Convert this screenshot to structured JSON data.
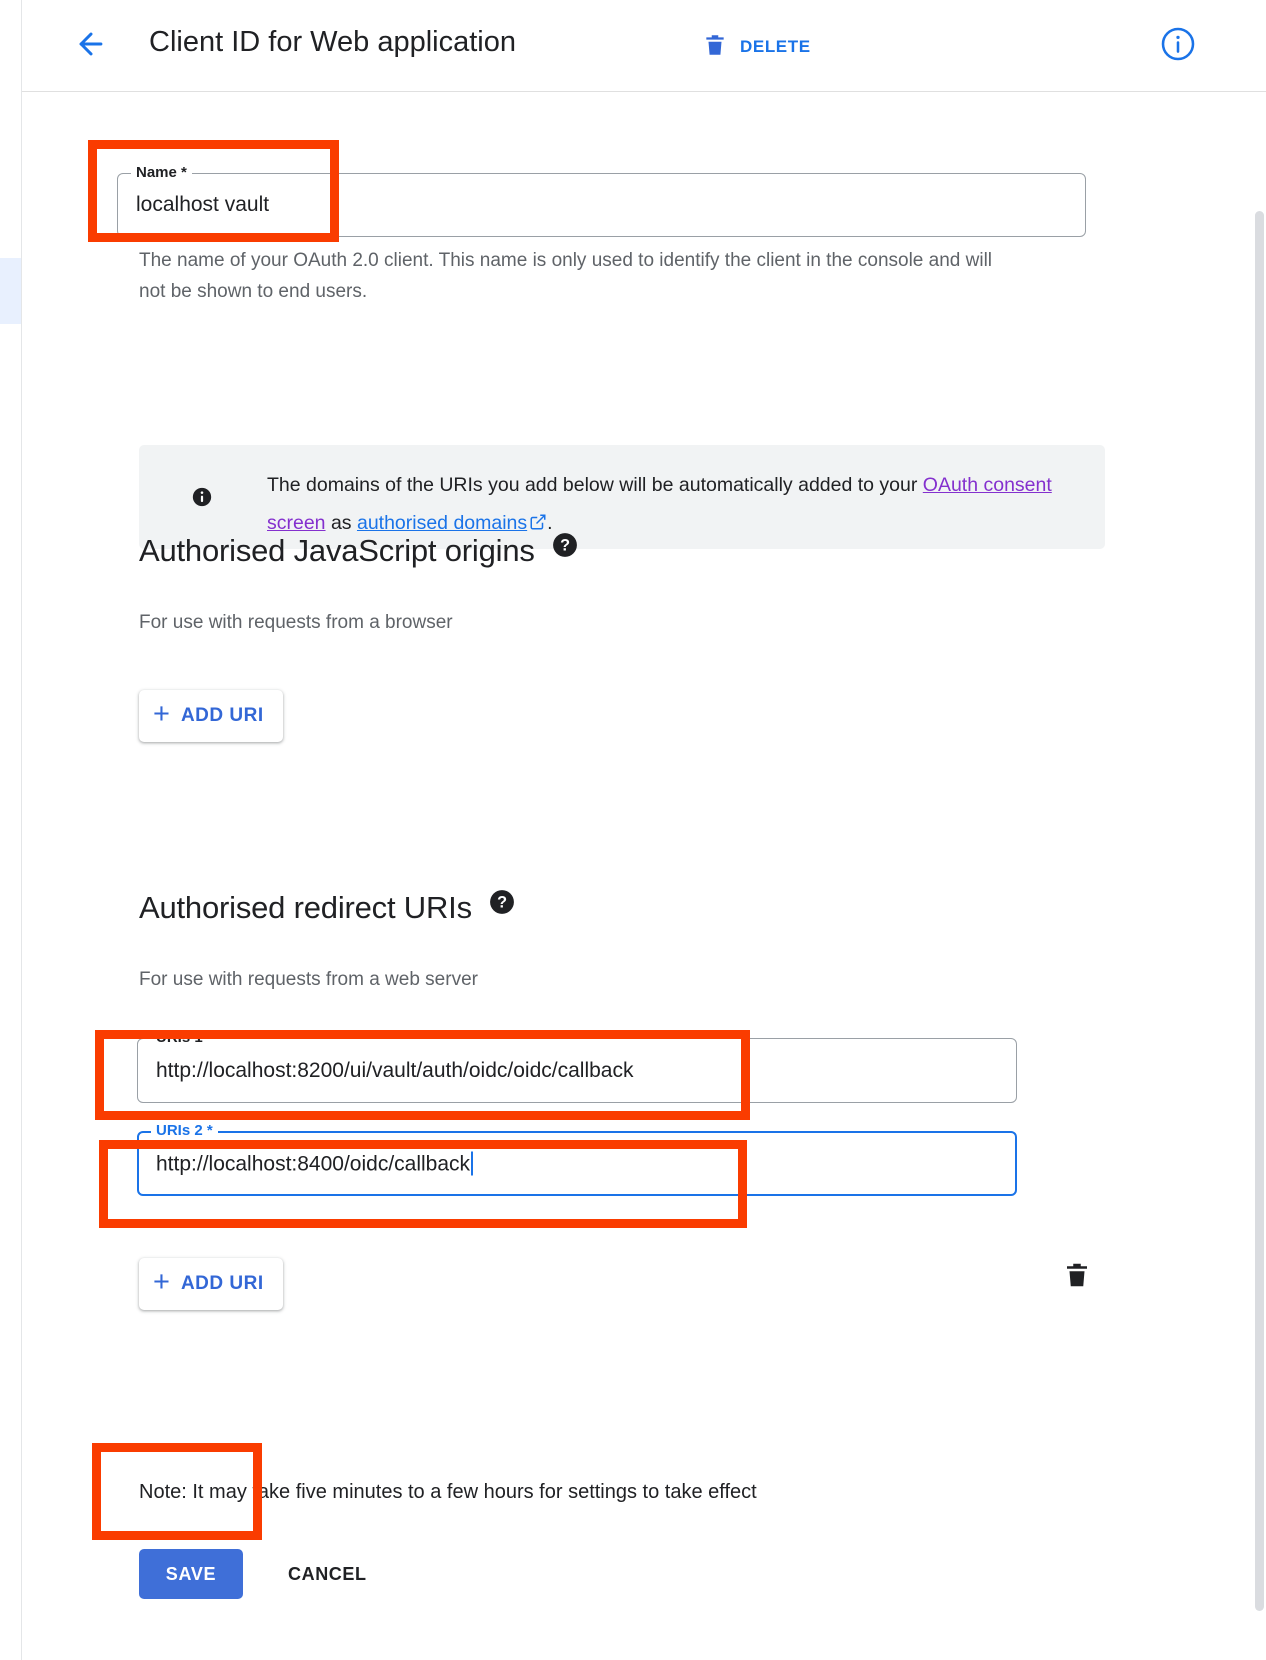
{
  "header": {
    "back_icon": "arrow-left-icon",
    "title": "Client ID for Web application",
    "delete_label": "DELETE",
    "delete_icon": "trash-icon",
    "info_icon": "info-circle-icon"
  },
  "name_field": {
    "label": "Name *",
    "value": "localhost vault",
    "helper": "The name of your OAuth 2.0 client. This name is only used to identify the client in the console and will not be shown to end users."
  },
  "banner": {
    "icon": "info-filled-icon",
    "text_part1": "The domains of the URIs you add below will be automatically added to your ",
    "link_consent": "OAuth consent screen",
    "text_part2": " as ",
    "link_domains": "authorised domains",
    "external_icon": "external-link-icon",
    "text_part3": "."
  },
  "js_origins": {
    "heading": "Authorised JavaScript origins",
    "help_icon": "help-circle-icon",
    "subtitle": "For use with requests from a browser",
    "add_uri_label": "ADD URI",
    "add_icon": "plus-icon"
  },
  "redirect_uris": {
    "heading": "Authorised redirect URIs",
    "help_icon": "help-circle-icon",
    "subtitle": "For use with requests from a web server",
    "add_uri_label": "ADD URI",
    "add_icon": "plus-icon",
    "delete_row_icon": "trash-icon",
    "rows": [
      {
        "label": "URIs 1 *",
        "value": "http://localhost:8200/ui/vault/auth/oidc/oidc/callback",
        "focused": false
      },
      {
        "label": "URIs 2 *",
        "value": "http://localhost:8400/oidc/callback",
        "focused": true
      }
    ]
  },
  "footer": {
    "note": "Note: It may take five minutes to a few hours for settings to take effect",
    "save_label": "SAVE",
    "cancel_label": "CANCEL"
  },
  "colors": {
    "accent_blue": "#1a73e8",
    "button_blue": "#3f6fd8",
    "visited_link_purple": "#8430ce",
    "annotation_red": "#fa3c00",
    "banner_grey": "#f1f3f4",
    "text_primary": "#202124",
    "text_secondary": "#5f6368"
  }
}
